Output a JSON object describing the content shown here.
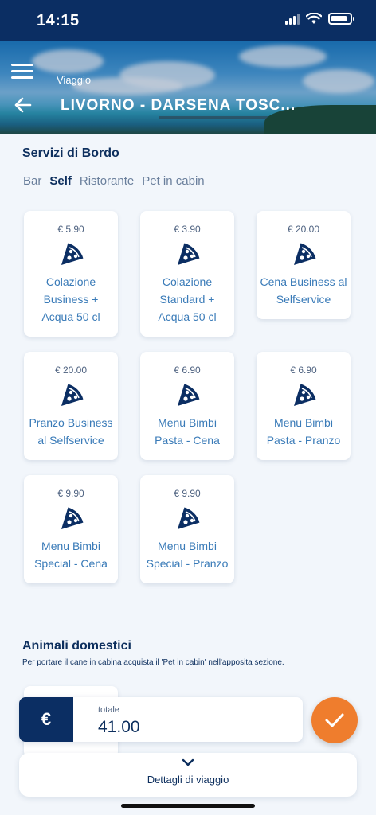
{
  "status_bar": {
    "time": "14:15"
  },
  "header": {
    "subtitle": "Viaggio",
    "title": "LIVORNO - DARSENA TOSC..."
  },
  "services": {
    "title": "Servizi di Bordo",
    "tabs": [
      {
        "label": "Bar",
        "active": false
      },
      {
        "label": "Self",
        "active": true
      },
      {
        "label": "Ristorante",
        "active": false
      },
      {
        "label": "Pet in cabin",
        "active": false
      }
    ],
    "items": [
      {
        "price": "€ 5.90",
        "name": "Colazione Business + Acqua 50 cl",
        "icon": "pizza-slice-icon"
      },
      {
        "price": "€ 3.90",
        "name": "Colazione Standard + Acqua 50 cl",
        "icon": "pizza-slice-icon"
      },
      {
        "price": "€ 20.00",
        "name": "Cena Business al Selfservice",
        "icon": "pizza-slice-icon"
      },
      {
        "price": "€ 20.00",
        "name": "Pranzo Business al Selfservice",
        "icon": "pizza-slice-icon"
      },
      {
        "price": "€ 6.90",
        "name": "Menu Bimbi Pasta - Cena",
        "icon": "pizza-slice-icon"
      },
      {
        "price": "€ 6.90",
        "name": "Menu Bimbi Pasta - Pranzo",
        "icon": "pizza-slice-icon"
      },
      {
        "price": "€ 9.90",
        "name": "Menu Bimbi Special - Cena",
        "icon": "pizza-slice-icon"
      },
      {
        "price": "€ 9.90",
        "name": "Menu Bimbi Special - Pranzo",
        "icon": "pizza-slice-icon"
      }
    ]
  },
  "animals": {
    "title": "Animali domestici",
    "description": "Per portare il cane in cabina acquista il 'Pet in cabin' nell'apposita sezione."
  },
  "total": {
    "currency_symbol": "€",
    "label": "totale",
    "value": "41.00"
  },
  "details": {
    "label": "Dettagli di viaggio"
  },
  "colors": {
    "navy": "#0b2e63",
    "accent_orange": "#ef7d2d",
    "item_text": "#3a7bb8",
    "background": "#f2f6fb"
  }
}
